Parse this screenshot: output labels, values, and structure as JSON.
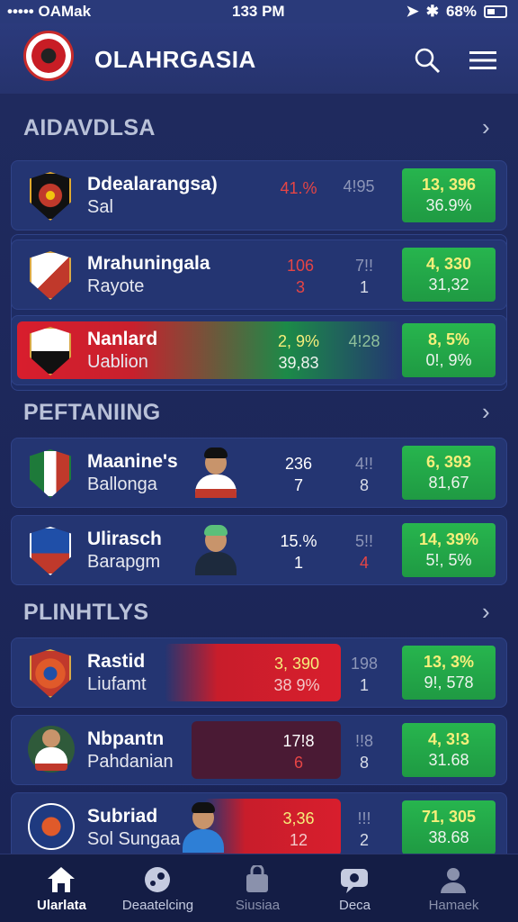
{
  "status_bar": {
    "carrier": "••••• OAMak",
    "time": "133 PM",
    "battery": "68%"
  },
  "header": {
    "title": "OLAHRGASIA"
  },
  "sections": [
    {
      "title": "AIDAVDLSA"
    },
    {
      "title": "PEFTANIING"
    },
    {
      "title": "PLINHTLYS"
    }
  ],
  "rows": [
    {
      "name": "Ddealarangsa)",
      "sub": "Sal",
      "v1a": "41.%",
      "v1b": "",
      "v2a": "4!95",
      "v2b": "",
      "ga": "13, 396",
      "gb": "36.9%"
    },
    {
      "name": "Mrahuningala",
      "sub": "Rayote",
      "v1a": "106",
      "v1b": "3",
      "v2a": "7!!",
      "v2b": "1",
      "ga": "4, 330",
      "gb": "31,32"
    },
    {
      "name": "Nanlard",
      "sub": "Uablion",
      "v1a": "2, 9%",
      "v1b": "39,83",
      "v2a": "4!28",
      "v2b": "",
      "ga": "8, 5%",
      "gb": "0!, 9%"
    },
    {
      "name": "Maanine's",
      "sub": "Ballonga",
      "v1a": "236",
      "v1b": "7",
      "v2a": "4!!",
      "v2b": "8",
      "ga": "6, 393",
      "gb": "81,67"
    },
    {
      "name": "Ulirasch",
      "sub": "Barapgm",
      "v1a": "15.%",
      "v1b": "1",
      "v2a": "5!!",
      "v2b": "4",
      "ga": "14, 39%",
      "gb": "5!, 5%"
    },
    {
      "name": "Rastid",
      "sub": "Liufamt",
      "v1a": "3, 390",
      "v1b": "38 9%",
      "v2a": "198",
      "v2b": "1",
      "ga": "13, 3%",
      "gb": "9!, 578"
    },
    {
      "name": "Nbpantn",
      "sub": "Pahdanian",
      "v1a": "17!8",
      "v1b": "6",
      "v2a": "!!8",
      "v2b": "8",
      "ga": "4, 3!3",
      "gb": "31.68"
    },
    {
      "name": "Subriad",
      "sub": "Sol Sungaa",
      "v1a": "3,36",
      "v1b": "12",
      "v2a": "!!!",
      "v2b": "2",
      "ga": "71, 305",
      "gb": "38.68"
    }
  ],
  "nav": [
    {
      "label": "Ularlata",
      "icon": "home-icon"
    },
    {
      "label": "Deaatelcing",
      "icon": "ball-icon"
    },
    {
      "label": "Siusiaa",
      "icon": "bag-icon"
    },
    {
      "label": "Deca",
      "icon": "chat-icon"
    },
    {
      "label": "Hamaek",
      "icon": "profile-icon"
    }
  ],
  "colors": {
    "background": "#1b2553",
    "card": "#243572",
    "green": "#27b54e",
    "red": "#d81e2d",
    "yellow": "#f6ef7a"
  }
}
